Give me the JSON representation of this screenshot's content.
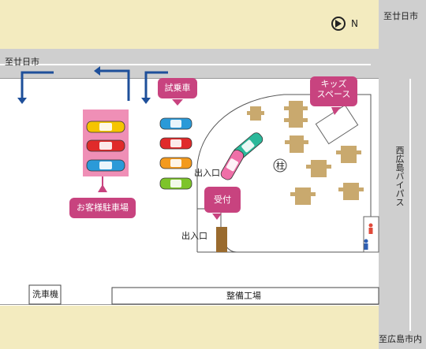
{
  "labels": {
    "north": "N",
    "to_hatsukaichi_top": "至廿日市",
    "to_hatsukaichi_left": "至廿日市",
    "to_hiroshima_city": "至広島市内",
    "bypass": "西広島バイパス",
    "test_drive": "試乗車",
    "kids_space": "キッズスペース",
    "kids_space_line1": "キッズ",
    "kids_space_line2": "スペース",
    "customer_parking": "お客様駐車場",
    "reception": "受付",
    "entrance_upper": "出入口",
    "entrance_lower": "出入口",
    "pillar": "柱",
    "car_wash": "洗車機",
    "maintenance_shop": "整備工場"
  },
  "colors": {
    "road": "#cfcfcf",
    "ground": "#f3ebbf",
    "tag": "#c8437f",
    "parking_area": "#ef8fb6",
    "arrow": "#1e4f9a",
    "table": "#c9a96e",
    "door": "#9a6b2e"
  },
  "parking_cars": [
    "yellow",
    "red",
    "blue"
  ],
  "test_drive_cars": [
    "blue",
    "red",
    "orange",
    "green"
  ],
  "showroom_cars": [
    "teal",
    "pink"
  ]
}
